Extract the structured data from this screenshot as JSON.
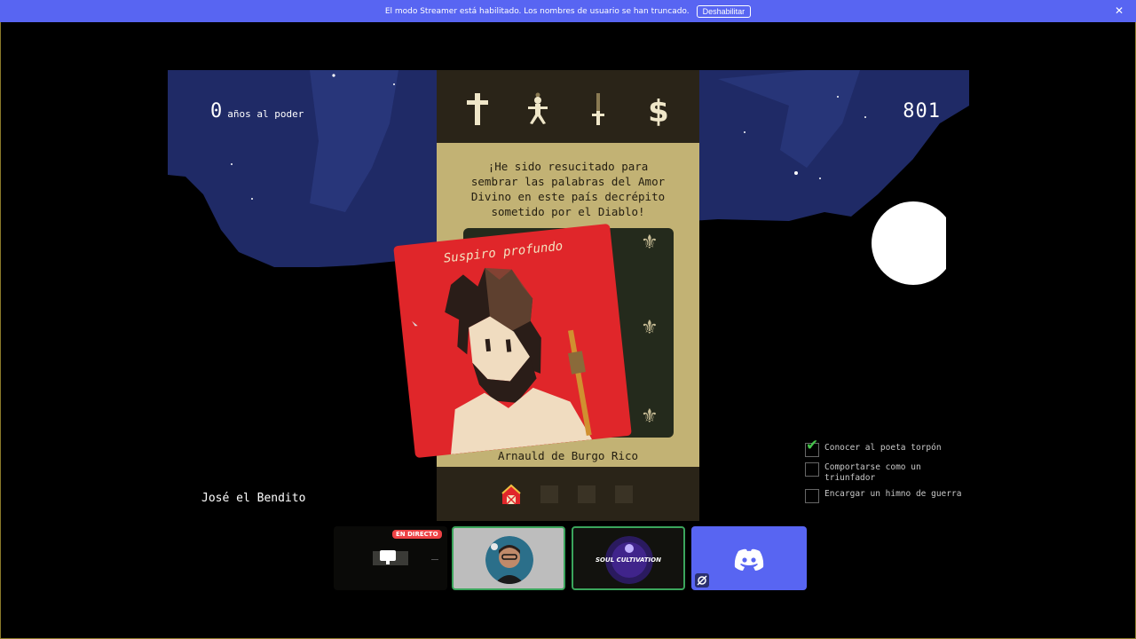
{
  "banner": {
    "message": "El modo Streamer está habilitado. Los nombres de usuario se han truncado.",
    "button_label": "Deshabilitar",
    "close_glyph": "✕"
  },
  "hud": {
    "reign_years": "0",
    "reign_label": "años al poder",
    "year": "801"
  },
  "stats": [
    {
      "name": "church",
      "icon": "cross-icon"
    },
    {
      "name": "people",
      "icon": "person-icon"
    },
    {
      "name": "army",
      "icon": "sword-icon"
    },
    {
      "name": "treasury",
      "icon": "dollar-icon"
    }
  ],
  "dialog": {
    "quote": "¡He sido resucitado para\nsembrar las palabras del Amor\nDivino en este país decrépito\nsometido por el Diablo!",
    "card_title": "Suspiro profundo",
    "speaker": "Arnauld de Burgo Rico",
    "fleur": "⚜"
  },
  "character": {
    "name": "José el Bendito"
  },
  "objectives": [
    {
      "label": "Conocer al poeta torpón",
      "done": true
    },
    {
      "label": "Comportarse como un triunfador",
      "done": false
    },
    {
      "label": "Encargar un himno de guerra",
      "done": false
    }
  ],
  "discord": {
    "live_badge": "EN DIRECTO",
    "soul_label": "SOUL CULTIVATION",
    "accent": "#5865f2",
    "speaking_color": "#3ba55c",
    "live_color": "#ed4245"
  },
  "colors": {
    "sky": "#1f2a66",
    "panel_dark": "#2a2418",
    "panel_parchment": "#c2b274",
    "card_red": "#e0262a"
  }
}
